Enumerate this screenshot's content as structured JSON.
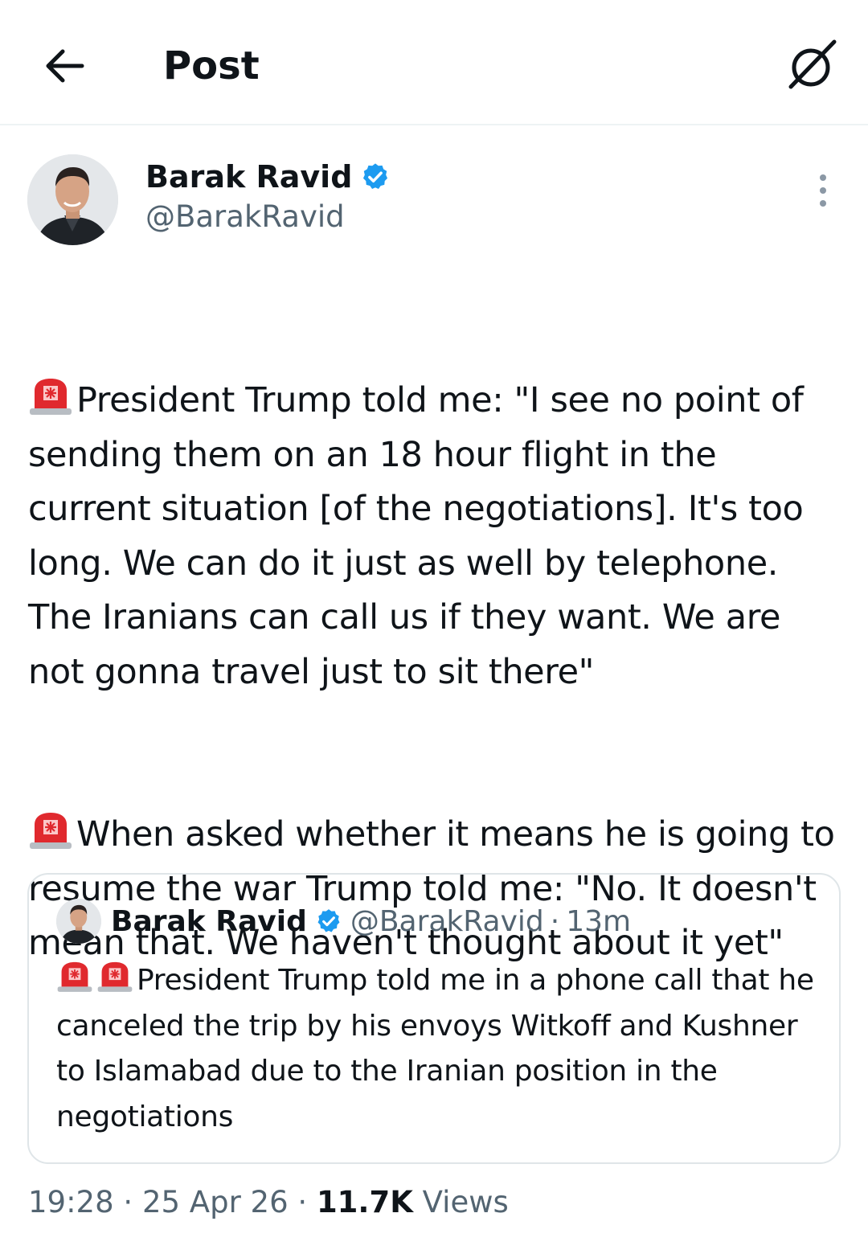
{
  "header": {
    "back_icon": "arrow-left-icon",
    "title": "Post",
    "grok_icon": "grok-icon"
  },
  "tweet": {
    "author_name": "Barak Ravid",
    "author_handle": "@BarakRavid",
    "verified_color": "#1d9bf0",
    "more_icon": "more-vertical-icon",
    "siren_icon": "police-car-light-icon",
    "paragraphs": [
      "President Trump told me: \"I see no point of sending them on an 18 hour flight in the current situation [of the negotiations]. It's too long. We can do it just as well by telephone. The Iranians can call us if they want. We are not gonna travel just to sit there\"",
      "When asked whether it means he is going to resume the war Trump told me: \"No. It doesn't mean that. We haven't thought about it yet\""
    ]
  },
  "quoted": {
    "author_name": "Barak Ravid",
    "author_handle": "@BarakRavid",
    "separator": "·",
    "time": "13m",
    "text": "President Trump told me in a phone call that he canceled the trip by his envoys Witkoff and Kushner to Islamabad due to the Iranian position in the negotiations"
  },
  "meta": {
    "time": "19:28",
    "sep1": "·",
    "date": "25 Apr 26",
    "sep2": "·",
    "views_count": "11.7K",
    "views_label": "Views"
  }
}
